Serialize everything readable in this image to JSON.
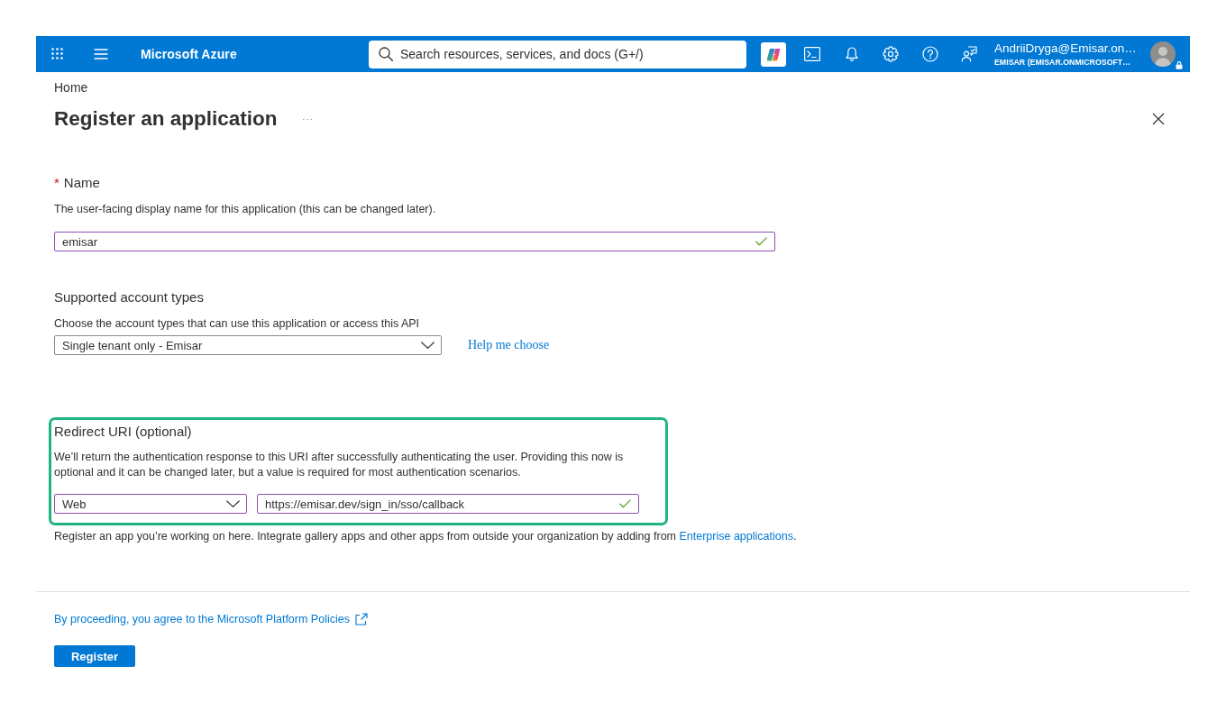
{
  "top_bar": {
    "brand": "Microsoft Azure",
    "search": {
      "placeholder": "Search resources, services, and docs (G+/)"
    },
    "account": {
      "name": "AndriiDryga@Emisar.on…",
      "directory": "EMISAR (EMISAR.ONMICROSOFT…"
    }
  },
  "breadcrumb": [
    {
      "label": "Home"
    }
  ],
  "page_title": "Register an application",
  "form": {
    "name": {
      "required_mark": "*",
      "label": "Name",
      "description": "The user-facing display name for this application (this can be changed later).",
      "value": "emisar",
      "valid": true
    },
    "account_types": {
      "label": "Supported account types",
      "description": "Choose the account types that can use this application or access this API",
      "value": "Single tenant only - Emisar",
      "help_link": "Help me choose"
    },
    "redirect_uri": {
      "highlighted": true,
      "label": "Redirect URI (optional)",
      "description": "We’ll return the authentication response to this URI after successfully authenticating the user. Providing this now is optional and it can be changed later, but a value is required for most authentication scenarios.",
      "platform": "Web",
      "value": "https://emisar.dev/sign_in/sso/callback",
      "valid": true
    },
    "note": {
      "text": "Register an app you’re working on here. Integrate gallery apps and other apps from outside your organization by adding from ",
      "link": "Enterprise applications",
      "end": "."
    }
  },
  "footer": {
    "policy_link": "By proceeding, you agree to the Microsoft Platform Policies",
    "button": "Register"
  }
}
